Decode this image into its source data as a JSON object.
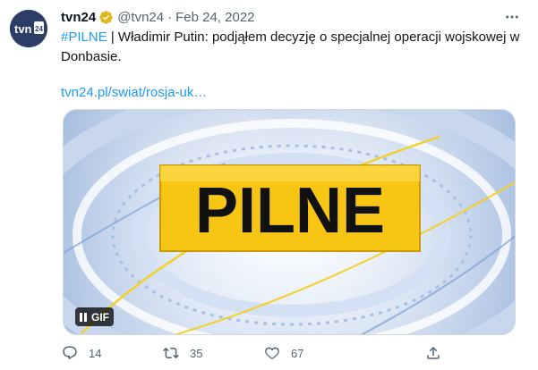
{
  "tweet": {
    "author_name": "tvn24",
    "handle": "@tvn24",
    "separator": "·",
    "date": "Feb 24, 2022",
    "hashtag": "#PILNE",
    "body": " | Władimir Putin: podjąłem decyzję o specjalnej operacji wojskowej w Donbasie.",
    "link": "tvn24.pl/swiat/rosja-uk…",
    "avatar_text": "tvn24"
  },
  "media": {
    "banner_text": "PILNE",
    "gif_label": "GIF"
  },
  "actions": {
    "replies": "14",
    "retweets": "35",
    "likes": "67"
  },
  "colors": {
    "accent": "#1d9bf0",
    "verified": "#e2b719",
    "banner_yellow": "#f7c514"
  },
  "icons": [
    "verified-badge-icon",
    "more-icon",
    "pause-icon",
    "reply-icon",
    "retweet-icon",
    "like-icon",
    "share-icon"
  ]
}
